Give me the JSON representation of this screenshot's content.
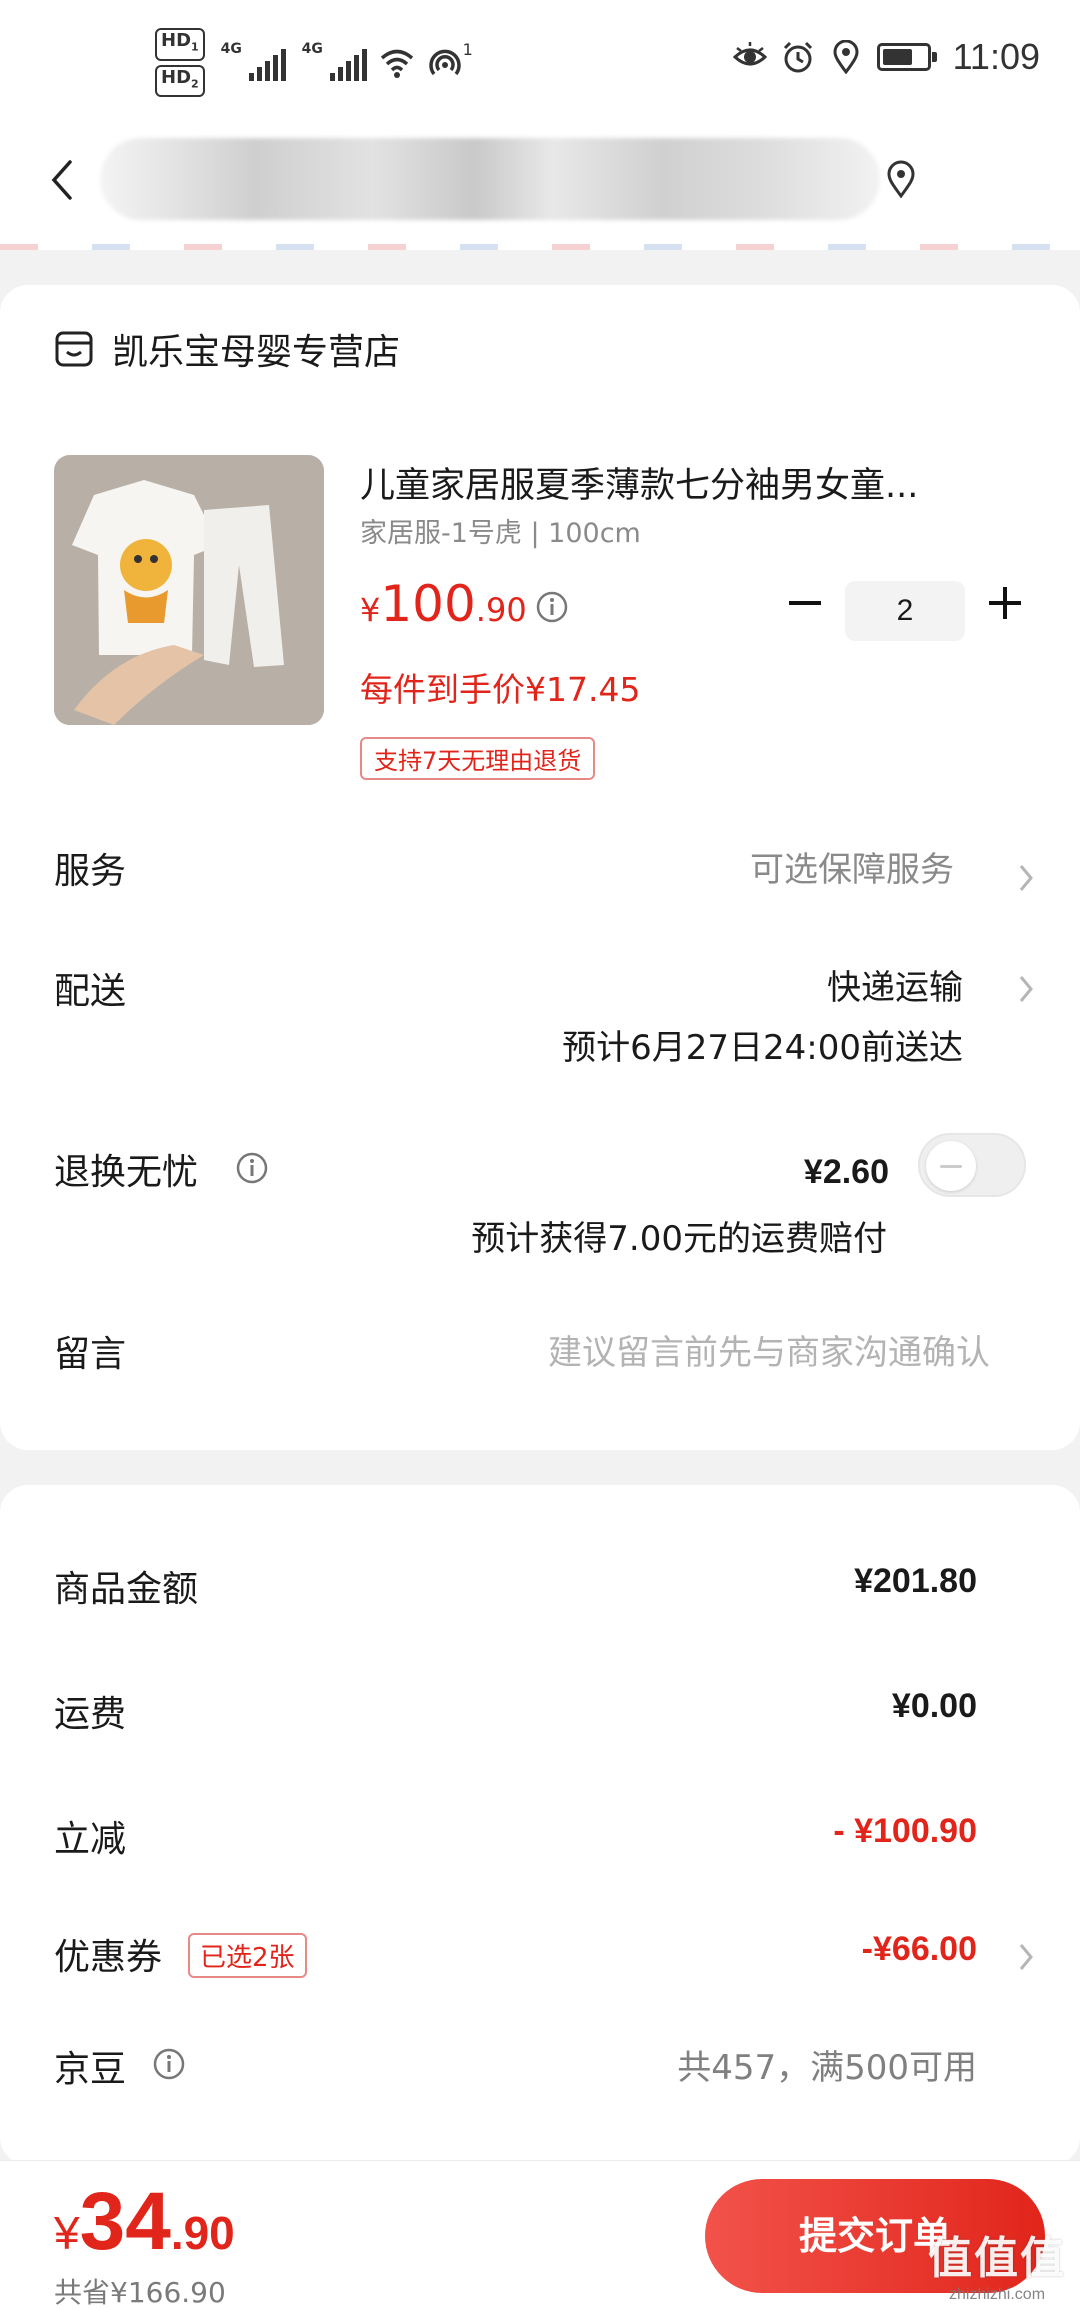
{
  "status_bar": {
    "hd1": "HD",
    "hd1_sub": "1",
    "hd2": "HD",
    "hd2_sub": "2",
    "net1": "4G",
    "net2": "4G",
    "hotspot_count": "1",
    "time": "11:09",
    "battery_level": 0.7
  },
  "order": {
    "shop_name": "凯乐宝母婴专营店",
    "product": {
      "title": "儿童家居服夏季薄款七分袖男女童...",
      "spec": "家居服-1号虎 | 100cm",
      "price_currency": "¥",
      "price_int": "100",
      "price_dec": ".90",
      "unit_price": "每件到手价¥17.45",
      "return_tag": "支持7天无理由退货",
      "quantity": "2"
    },
    "service": {
      "label": "服务",
      "value": "可选保障服务"
    },
    "delivery": {
      "label": "配送",
      "method": "快递运输",
      "eta": "预计6月27日24:00前送达"
    },
    "return_insurance": {
      "label": "退换无忧",
      "price": "¥2.60",
      "note": "预计获得7.00元的运费赔付",
      "enabled": false
    },
    "message": {
      "label": "留言",
      "placeholder": "建议留言前先与商家沟通确认"
    }
  },
  "summary": {
    "goods_amount": {
      "label": "商品金额",
      "value": "¥201.80"
    },
    "shipping": {
      "label": "运费",
      "value": "¥0.00"
    },
    "discount": {
      "label": "立减",
      "value": "- ¥100.90"
    },
    "coupon": {
      "label": "优惠券",
      "tag": "已选2张",
      "value": "-¥66.00"
    },
    "beans": {
      "label": "京豆",
      "value": "共457，满500可用"
    }
  },
  "bottom": {
    "total_currency": "¥",
    "total_int": "34",
    "total_dec": ".90",
    "saved": "共省¥166.90",
    "submit_label": "提交订单"
  },
  "watermark": {
    "logo": "值值值",
    "sub": "zhizhizhi.com"
  },
  "colors": {
    "accent": "#e1251b",
    "background": "#f2f2f2",
    "card": "#ffffff"
  }
}
